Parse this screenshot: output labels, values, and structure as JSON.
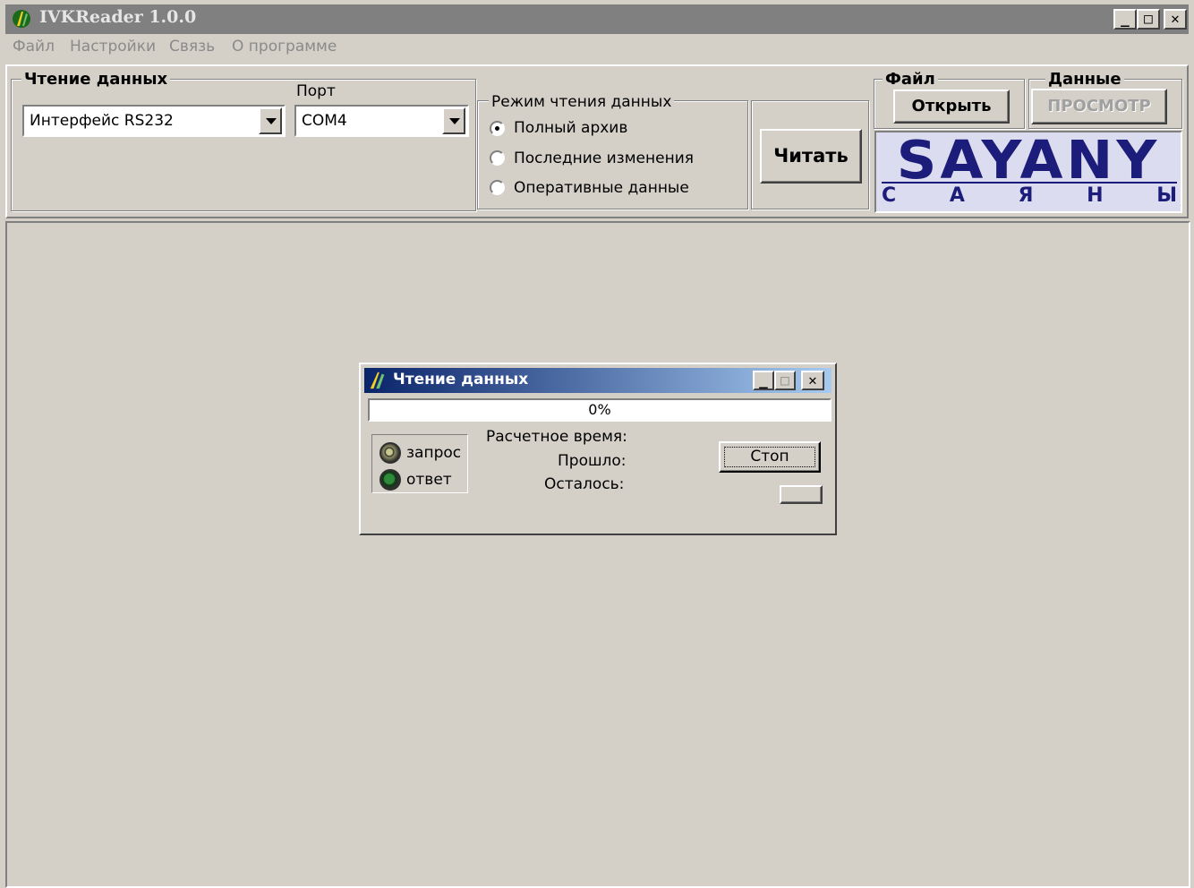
{
  "window": {
    "title": "IVKReader 1.0.0"
  },
  "menu": [
    "Файл",
    "Настройки",
    "Связь",
    "О программе"
  ],
  "read_group": {
    "legend": "Чтение данных",
    "interface_value": "Интерфейс RS232",
    "port_label": "Порт",
    "port_value": "COM4"
  },
  "mode_group": {
    "legend": "Режим чтения данных",
    "options": [
      "Полный архив",
      "Последние изменения",
      "Оперативные данные"
    ],
    "selected": 0
  },
  "read_button": "Читать",
  "file_group": {
    "legend": "Файл",
    "open_button": "Открыть"
  },
  "data_group": {
    "legend": "Данные",
    "view_button": "ПРОСМОТР"
  },
  "logo": {
    "main": "SAYANY",
    "letters": [
      "С",
      "А",
      "Я",
      "Н",
      "Ы"
    ]
  },
  "dialog": {
    "title": "Чтение данных",
    "progress": "0%",
    "progress_fraction": 0,
    "request_label": "запрос",
    "response_label": "ответ",
    "estimated_label": "Расчетное время:",
    "elapsed_label": "Прошло:",
    "remaining_label": "Осталось:",
    "stop_button": "Стоп"
  },
  "colors": {
    "face": "#d4d0c8",
    "title_active": "#0a246a",
    "title_inactive": "#808080",
    "logo_blue": "#1c1c7a"
  }
}
